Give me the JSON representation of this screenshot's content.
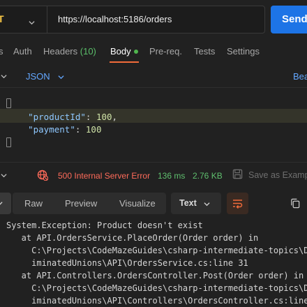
{
  "request": {
    "method": "T",
    "url": "https://localhost:5186/orders",
    "send_label": "Send"
  },
  "request_tabs": {
    "params_partial": "s",
    "auth": "Auth",
    "headers": "Headers",
    "headers_count": "(10)",
    "body": "Body",
    "prereq": "Pre-req.",
    "tests": "Tests",
    "settings": "Settings"
  },
  "body_options": {
    "language": "JSON",
    "beautify_partial": "Bea"
  },
  "editor": {
    "line1_key": "\"productId\"",
    "line1_punct": ": ",
    "line1_value": "100",
    "line1_comma": ",",
    "line2_key": "\"payment\"",
    "line2_punct": ": ",
    "line2_value": "100"
  },
  "response": {
    "status": "500 Internal Server Error",
    "time": "136 ms",
    "size": "2.76 KB",
    "save_label": "Save as Examp",
    "tabs": {
      "raw": "Raw",
      "preview": "Preview",
      "visualize": "Visualize"
    },
    "format": "Text",
    "body_lines": [
      "System.Exception: Product doesn't exist",
      "   at API.OrdersService.PlaceOrder(Order order) in",
      "     C:\\Projects\\CodeMazeGuides\\csharp-intermediate-topics\\D",
      "     iminatedUnions\\API\\OrdersService.cs:line 31",
      "   at API.Controllers.OrdersController.Post(Order order) in",
      "     C:\\Projects\\CodeMazeGuides\\csharp-intermediate-topics\\D",
      "     iminatedUnions\\API\\Controllers\\OrdersController.cs:line"
    ]
  },
  "colors": {
    "method": "#f5c445",
    "send": "#1d74e6",
    "accent_tab": "#f26b3a",
    "link": "#63a7ff",
    "error": "#ff6b5a",
    "success": "#5fbf6e"
  },
  "icons": {
    "method_chevron": "chevron-down-icon",
    "body_dot": "dot-icon",
    "globe_error": "globe-error-icon",
    "save": "save-icon",
    "wrap": "wrap-lines-icon",
    "copy": "copy-icon"
  }
}
